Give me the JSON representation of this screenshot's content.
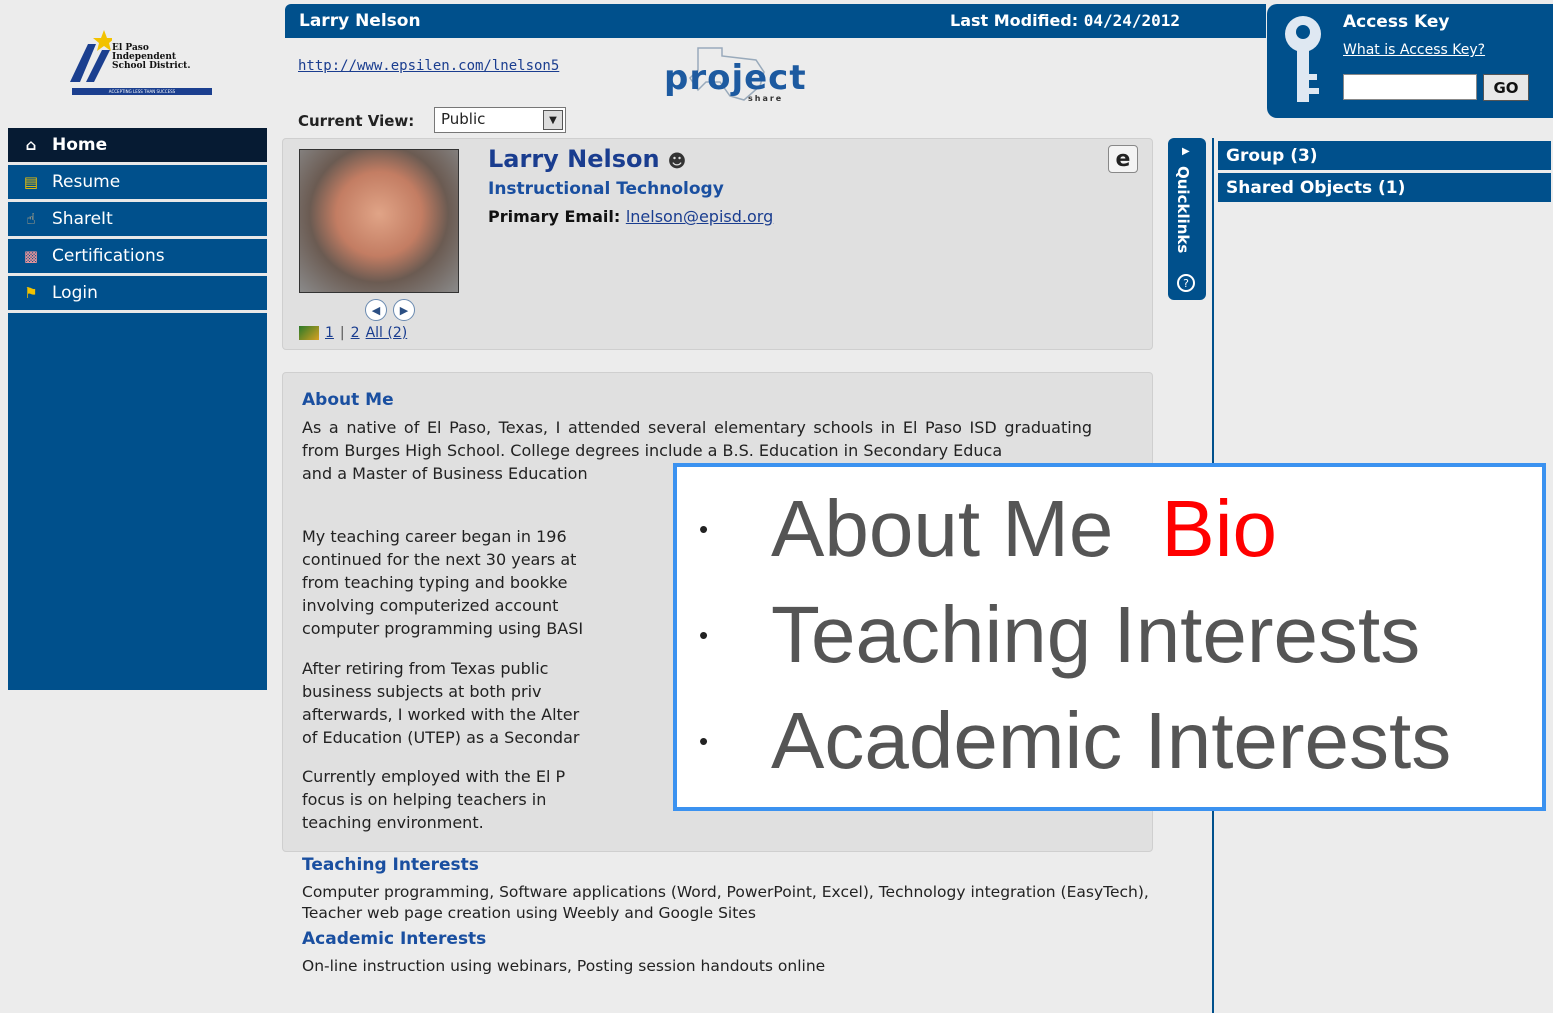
{
  "logo": {
    "org_line1": "El Paso",
    "org_line2": "Independent",
    "org_line3": "School District.",
    "tagline": "ACCEPTING LESS THAN SUCCESS"
  },
  "nav": {
    "items": [
      {
        "label": "Home",
        "icon": "house-icon"
      },
      {
        "label": "Resume",
        "icon": "resume-icon"
      },
      {
        "label": "ShareIt",
        "icon": "hand-share-icon"
      },
      {
        "label": "Certifications",
        "icon": "certificate-icon"
      },
      {
        "label": "Login",
        "icon": "login-icon"
      }
    ]
  },
  "header": {
    "name": "Larry Nelson",
    "last_modified_label": "Last Modified:",
    "last_modified_date": "04/24/2012",
    "profile_url": "http://www.epsilen.com/lnelson5",
    "brand_word": "project",
    "brand_sub": "share"
  },
  "access_key": {
    "title": "Access Key",
    "what_link": "What is Access Key?",
    "input_value": "",
    "go_label": "GO"
  },
  "view": {
    "label": "Current View:",
    "selected": "Public"
  },
  "profile": {
    "name": "Larry Nelson",
    "department": "Instructional Technology",
    "email_label": "Primary Email:",
    "email": "lnelson@episd.org",
    "photo_pages": [
      "1",
      "|",
      "2",
      "All (2)"
    ],
    "edit_icon_glyph": "e"
  },
  "quicklinks": {
    "label": "Quicklinks"
  },
  "right_col": {
    "group_label": "Group (3)",
    "shared_label": "Shared Objects (1)"
  },
  "about": {
    "title": "About Me",
    "p1": "As a native of El Paso, Texas, I attended several elementary schools in El Paso ISD graduating from Burges High School.  College degrees include a B.S. Education in Secondary Educa",
    "p1b": "and a Master of Business Education",
    "p2_l1": "My teaching career began in 196",
    "p2_l2": "continued for the next 30 years at",
    "p2_l3": "from teaching typing and bookke",
    "p2_l4": "involving computerized account",
    "p2_l5": "computer programming using BASI",
    "p3_l1": "After retiring from Texas public",
    "p3_l2": "business subjects at both priv",
    "p3_l3": "afterwards, I worked with the Alter",
    "p3_l4": "of Education (UTEP) as a Secondar",
    "p4_l1": "Currently employed with the El P",
    "p4_l2": "focus is on helping teachers in",
    "p4_l3": "teaching environment."
  },
  "teaching": {
    "title": "Teaching Interests",
    "text": "Computer programming, Software applications (Word, PowerPoint, Excel), Technology integration (EasyTech), Teacher web page creation using Weebly and Google Sites"
  },
  "academic": {
    "title": "Academic Interests",
    "text": "On-line instruction using webinars, Posting session handouts online"
  },
  "overlay": {
    "bullet": "•",
    "item1": "About Me",
    "item1_highlight": "Bio",
    "item2": "Teaching Interests",
    "item3": "Academic Interests",
    "highlight_color": "#ff0000",
    "border_color": "#3b92f0"
  }
}
